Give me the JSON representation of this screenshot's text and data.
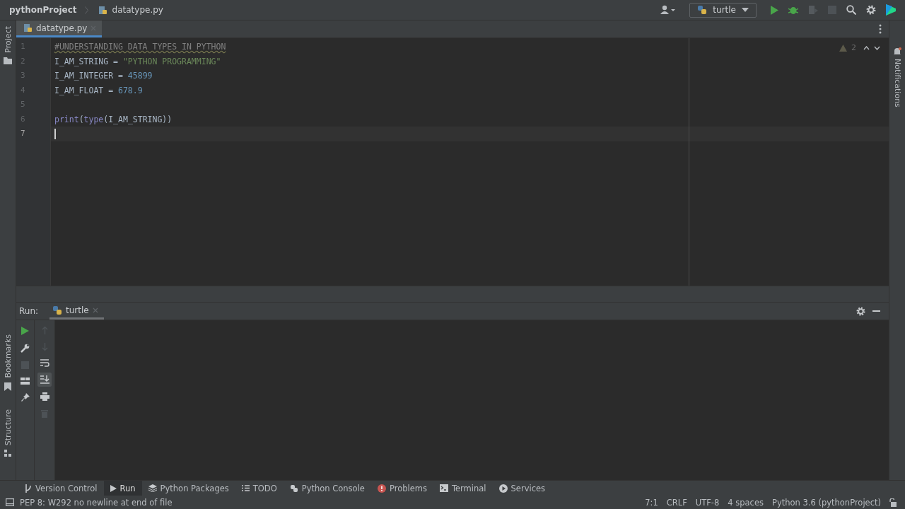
{
  "breadcrumbs": [
    "pythonProject",
    "datatype.py"
  ],
  "run_config": "turtle",
  "left_tabs": {
    "top": [
      "Project"
    ],
    "bottom": [
      "Bookmarks",
      "Structure"
    ]
  },
  "right_tabs": [
    "Notifications"
  ],
  "editor_tabs": [
    {
      "label": "datatype.py",
      "selected": true
    }
  ],
  "editor": {
    "warnings": "2",
    "lines": [
      {
        "number": "1",
        "current": false,
        "tokens": [
          {
            "kind": "comment",
            "text": "#UNDERSTANDING DATA TYPES IN PYTHON"
          }
        ]
      },
      {
        "number": "2",
        "current": false,
        "tokens": [
          {
            "kind": "plain",
            "text": "I_AM_STRING = "
          },
          {
            "kind": "string",
            "text": "\"PYTHON PROGRAMMING\""
          }
        ]
      },
      {
        "number": "3",
        "current": false,
        "tokens": [
          {
            "kind": "plain",
            "text": "I_AM_INTEGER = "
          },
          {
            "kind": "number",
            "text": "45899"
          }
        ]
      },
      {
        "number": "4",
        "current": false,
        "tokens": [
          {
            "kind": "plain",
            "text": "I_AM_FLOAT = "
          },
          {
            "kind": "number",
            "text": "678.9"
          }
        ]
      },
      {
        "number": "5",
        "current": false
      },
      {
        "number": "6",
        "current": false,
        "tokens": [
          {
            "kind": "builtin",
            "text": "print"
          },
          {
            "kind": "plain",
            "text": "("
          },
          {
            "kind": "builtin",
            "text": "type"
          },
          {
            "kind": "plain",
            "text": "(I_AM_STRING))"
          }
        ]
      },
      {
        "number": "7",
        "current": true
      }
    ]
  },
  "run_panel": {
    "label": "Run:",
    "tab": "turtle"
  },
  "tool_windows": [
    {
      "label": "Version Control",
      "selected": false
    },
    {
      "label": "Run",
      "selected": true
    },
    {
      "label": "Python Packages",
      "selected": false
    },
    {
      "label": "TODO",
      "selected": false
    },
    {
      "label": "Python Console",
      "selected": false
    },
    {
      "label": "Problems",
      "selected": false
    },
    {
      "label": "Terminal",
      "selected": false
    },
    {
      "label": "Services",
      "selected": false
    }
  ],
  "status_bar": {
    "message": "PEP 8: W292 no newline at end of file",
    "items": [
      "7:1",
      "CRLF",
      "UTF-8",
      "4 spaces",
      "Python 3.6 (pythonProject)"
    ]
  }
}
